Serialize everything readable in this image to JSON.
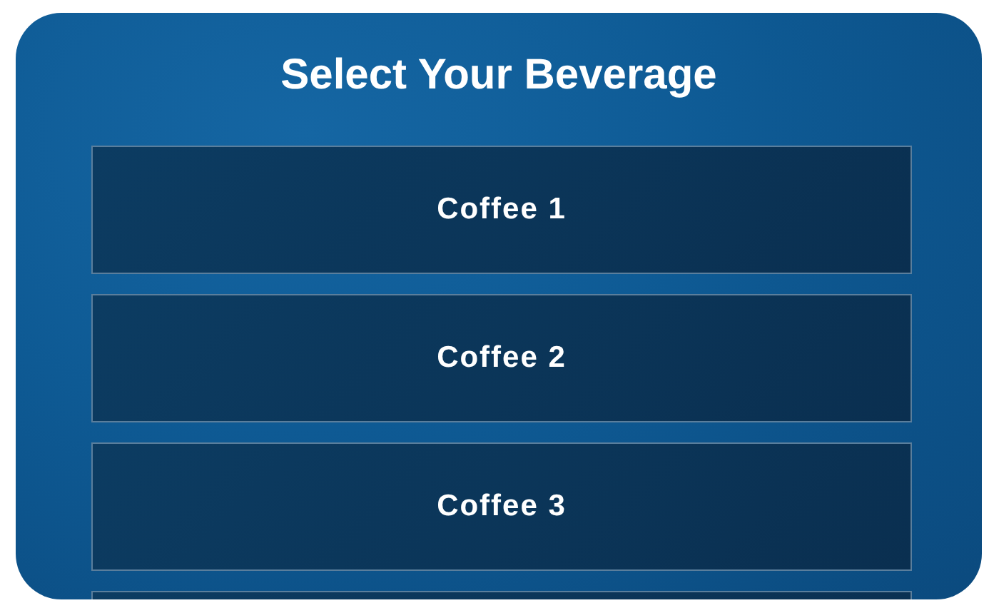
{
  "title": "Select Your Beverage",
  "items": [
    {
      "label": "Coffee 1"
    },
    {
      "label": "Coffee 2"
    },
    {
      "label": "Coffee 3"
    }
  ],
  "list_continues": true
}
